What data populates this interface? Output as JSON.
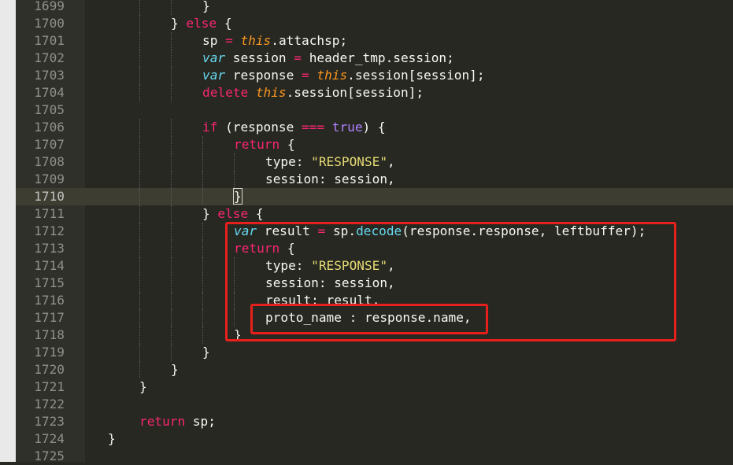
{
  "editor": {
    "first_line": 1699,
    "active_line": 1710,
    "lines": [
      {
        "n": "1699",
        "indent": 3,
        "tokens": [
          {
            "t": "}",
            "c": "pn"
          }
        ]
      },
      {
        "n": "1700",
        "indent": 2,
        "tokens": [
          {
            "t": "} ",
            "c": "pn"
          },
          {
            "t": "else",
            "c": "kw"
          },
          {
            "t": " {",
            "c": "pn"
          }
        ]
      },
      {
        "n": "1701",
        "indent": 3,
        "tokens": [
          {
            "t": "sp ",
            "c": "pn"
          },
          {
            "t": "=",
            "c": "kw"
          },
          {
            "t": " ",
            "c": "pn"
          },
          {
            "t": "this",
            "c": "sv"
          },
          {
            "t": ".attachsp;",
            "c": "pn"
          }
        ]
      },
      {
        "n": "1702",
        "indent": 3,
        "tokens": [
          {
            "t": "var",
            "c": "st"
          },
          {
            "t": " session ",
            "c": "pn"
          },
          {
            "t": "=",
            "c": "kw"
          },
          {
            "t": " header_tmp.session;",
            "c": "pn"
          }
        ]
      },
      {
        "n": "1703",
        "indent": 3,
        "tokens": [
          {
            "t": "var",
            "c": "st"
          },
          {
            "t": " response ",
            "c": "pn"
          },
          {
            "t": "=",
            "c": "kw"
          },
          {
            "t": " ",
            "c": "pn"
          },
          {
            "t": "this",
            "c": "sv"
          },
          {
            "t": ".session[session];",
            "c": "pn"
          }
        ]
      },
      {
        "n": "1704",
        "indent": 3,
        "tokens": [
          {
            "t": "delete",
            "c": "kw"
          },
          {
            "t": " ",
            "c": "pn"
          },
          {
            "t": "this",
            "c": "sv"
          },
          {
            "t": ".session[session];",
            "c": "pn"
          }
        ]
      },
      {
        "n": "1705",
        "indent": 0,
        "tokens": []
      },
      {
        "n": "1706",
        "indent": 3,
        "tokens": [
          {
            "t": "if",
            "c": "kw"
          },
          {
            "t": " (response ",
            "c": "pn"
          },
          {
            "t": "===",
            "c": "kw"
          },
          {
            "t": " ",
            "c": "pn"
          },
          {
            "t": "true",
            "c": "num"
          },
          {
            "t": ") {",
            "c": "pn"
          }
        ]
      },
      {
        "n": "1707",
        "indent": 4,
        "tokens": [
          {
            "t": "return",
            "c": "kw"
          },
          {
            "t": " {",
            "c": "pn"
          }
        ]
      },
      {
        "n": "1708",
        "indent": 5,
        "tokens": [
          {
            "t": "type: ",
            "c": "pn"
          },
          {
            "t": "\"RESPONSE\"",
            "c": "str"
          },
          {
            "t": ",",
            "c": "pn"
          }
        ]
      },
      {
        "n": "1709",
        "indent": 5,
        "tokens": [
          {
            "t": "session: session,",
            "c": "pn"
          }
        ]
      },
      {
        "n": "1710",
        "indent": 4,
        "tokens": [
          {
            "t": "}",
            "c": "cursor"
          }
        ]
      },
      {
        "n": "1711",
        "indent": 3,
        "tokens": [
          {
            "t": "} ",
            "c": "pn"
          },
          {
            "t": "else",
            "c": "kw"
          },
          {
            "t": " {",
            "c": "pn"
          }
        ]
      },
      {
        "n": "1712",
        "indent": 4,
        "tokens": [
          {
            "t": "var",
            "c": "st"
          },
          {
            "t": " result ",
            "c": "pn"
          },
          {
            "t": "=",
            "c": "kw"
          },
          {
            "t": " sp.",
            "c": "pn"
          },
          {
            "t": "decode",
            "c": "fn"
          },
          {
            "t": "(response.response, leftbuffer);",
            "c": "pn"
          }
        ]
      },
      {
        "n": "1713",
        "indent": 4,
        "tokens": [
          {
            "t": "return",
            "c": "kw"
          },
          {
            "t": " {",
            "c": "pn"
          }
        ]
      },
      {
        "n": "1714",
        "indent": 5,
        "tokens": [
          {
            "t": "type: ",
            "c": "pn"
          },
          {
            "t": "\"RESPONSE\"",
            "c": "str"
          },
          {
            "t": ",",
            "c": "pn"
          }
        ]
      },
      {
        "n": "1715",
        "indent": 5,
        "tokens": [
          {
            "t": "session: session,",
            "c": "pn"
          }
        ]
      },
      {
        "n": "1716",
        "indent": 5,
        "tokens": [
          {
            "t": "result: result,",
            "c": "pn"
          }
        ]
      },
      {
        "n": "1717",
        "indent": 5,
        "tokens": [
          {
            "t": "proto_name : response.name,",
            "c": "pn"
          }
        ]
      },
      {
        "n": "1718",
        "indent": 4,
        "tokens": [
          {
            "t": "}",
            "c": "pn"
          }
        ]
      },
      {
        "n": "1719",
        "indent": 3,
        "tokens": [
          {
            "t": "}",
            "c": "pn"
          }
        ]
      },
      {
        "n": "1720",
        "indent": 2,
        "tokens": [
          {
            "t": "}",
            "c": "pn"
          }
        ]
      },
      {
        "n": "1721",
        "indent": 1,
        "tokens": [
          {
            "t": "}",
            "c": "pn"
          }
        ]
      },
      {
        "n": "1722",
        "indent": 0,
        "tokens": []
      },
      {
        "n": "1723",
        "indent": 1,
        "tokens": [
          {
            "t": "return",
            "c": "kw"
          },
          {
            "t": " sp;",
            "c": "pn"
          }
        ]
      },
      {
        "n": "1724",
        "indent": 0,
        "tokens": [
          {
            "t": "}",
            "c": "pn"
          }
        ]
      },
      {
        "n": "1725",
        "indent": 0,
        "tokens": []
      }
    ]
  },
  "annotations": {
    "color": "#e8201b",
    "boxes": [
      {
        "name": "highlight-box-else-branch",
        "from_line": "1712",
        "to_line": "1718"
      },
      {
        "name": "highlight-box-proto-name",
        "from_line": "1717",
        "to_line": "1718"
      }
    ]
  },
  "theme": {
    "background": "#272822",
    "gutter_background": "#2f302a",
    "active_line_background": "#3e3d32",
    "text": "#f8f8f2",
    "keyword": "#f92672",
    "storage_type": "#66d9ef",
    "string": "#e6db74",
    "constant": "#ae81ff",
    "this_variable": "#fd971f"
  }
}
